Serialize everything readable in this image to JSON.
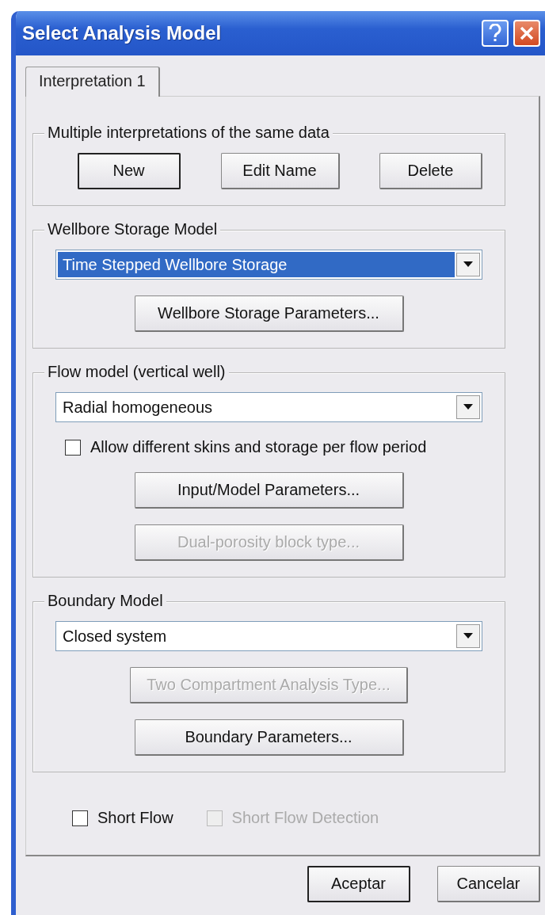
{
  "window": {
    "title": "Select Analysis Model"
  },
  "tabs": [
    {
      "label": "Interpretation 1",
      "selected": true
    }
  ],
  "groups": [
    {
      "title": "Multiple interpretations of the same data",
      "controls": [
        {
          "kind": "buttons",
          "buttons": [
            {
              "label": "New",
              "default": true,
              "disabled": false
            },
            {
              "label": "Edit Name",
              "default": false,
              "disabled": false
            },
            {
              "label": "Delete",
              "default": false,
              "disabled": false
            }
          ]
        }
      ]
    },
    {
      "title": "Wellbore Storage Model",
      "controls": [
        {
          "kind": "dropdown",
          "value": "Time Stepped Wellbore Storage",
          "focused": true
        },
        {
          "kind": "button",
          "label": "Wellbore Storage Parameters...",
          "disabled": false
        }
      ]
    },
    {
      "title": "Flow model (vertical well)",
      "controls": [
        {
          "kind": "dropdown",
          "value": "Radial homogeneous",
          "focused": false
        },
        {
          "kind": "checkbox",
          "label": "Allow different skins and storage per flow period",
          "checked": false,
          "disabled": false
        },
        {
          "kind": "button",
          "label": "Input/Model Parameters...",
          "disabled": false
        },
        {
          "kind": "button",
          "label": "Dual-porosity block type...",
          "disabled": true
        }
      ]
    },
    {
      "title": "Boundary Model",
      "controls": [
        {
          "kind": "dropdown",
          "value": "Closed system",
          "focused": false
        },
        {
          "kind": "button",
          "label": "Two Compartment Analysis Type...",
          "disabled": true
        },
        {
          "kind": "button",
          "label": "Boundary Parameters...",
          "disabled": false
        }
      ]
    }
  ],
  "options": [
    {
      "label": "Short Flow",
      "checked": false,
      "disabled": false
    },
    {
      "label": "Short Flow Detection",
      "checked": false,
      "disabled": true
    }
  ],
  "dialog_buttons": [
    {
      "label": "Aceptar",
      "default": true
    },
    {
      "label": "Cancelar",
      "default": false
    }
  ]
}
